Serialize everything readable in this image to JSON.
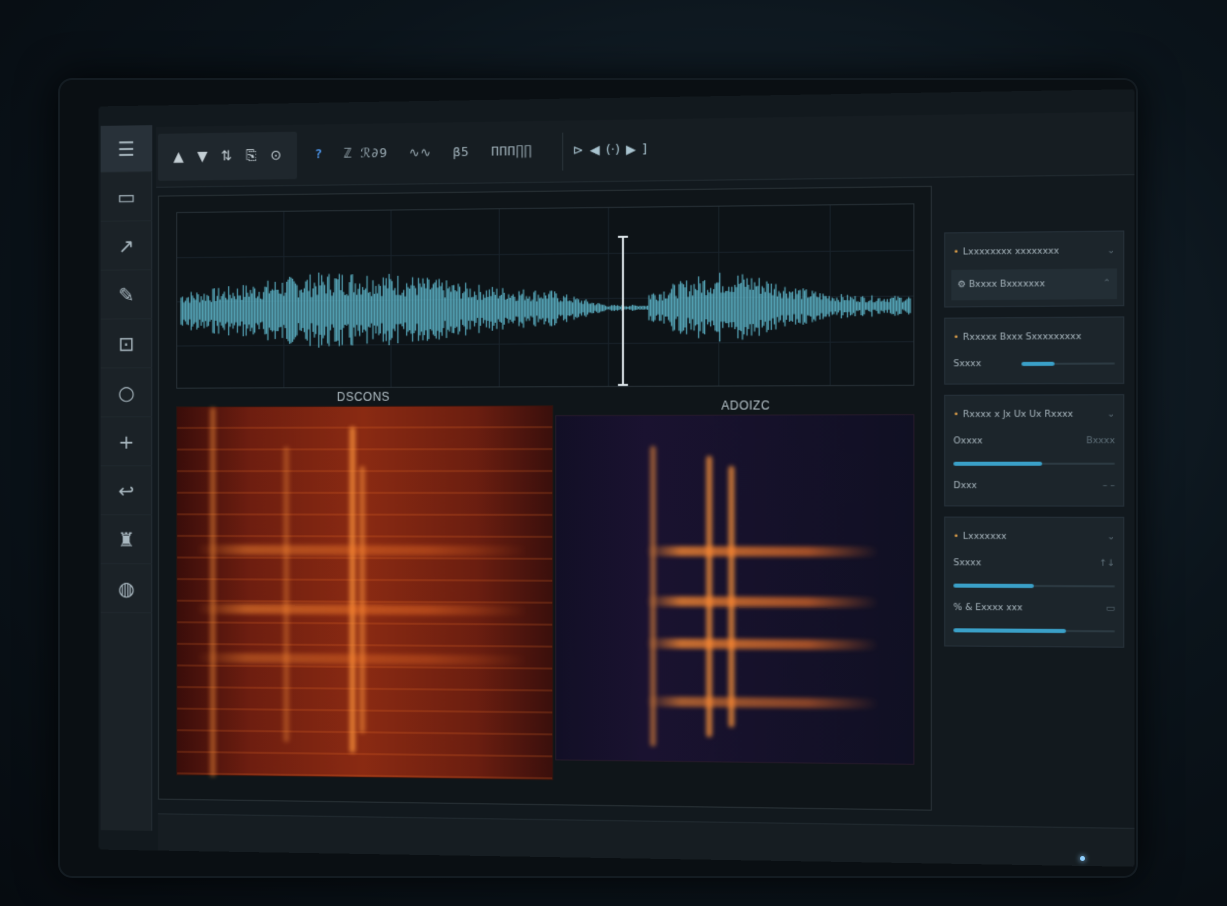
{
  "sidebar": {
    "items": [
      {
        "icon": "menu-icon",
        "glyph": "☰"
      },
      {
        "icon": "document-icon",
        "glyph": "▭"
      },
      {
        "icon": "hook-icon",
        "glyph": "↗"
      },
      {
        "icon": "pen-icon",
        "glyph": "✎"
      },
      {
        "icon": "clip-icon",
        "glyph": "⊡"
      },
      {
        "icon": "circle-icon",
        "glyph": "○"
      },
      {
        "icon": "plus-icon",
        "glyph": "+"
      },
      {
        "icon": "curve-icon",
        "glyph": "↩"
      },
      {
        "icon": "stamp-icon",
        "glyph": "♜"
      },
      {
        "icon": "globe-icon",
        "glyph": "◍"
      }
    ]
  },
  "toolbar": {
    "group_icons": [
      "▲",
      "▼",
      "⇅",
      "⎘",
      "⊙"
    ],
    "help": "?",
    "texts": [
      "ℤ ℛ∂9",
      "∿∿",
      "β5",
      "ΠΠΠ∏∏"
    ],
    "transport": {
      "left": "⊳",
      "prev": "◀",
      "play_pause": "(·)",
      "play": "▶",
      "end": "]"
    }
  },
  "main": {
    "wave_label": "DSCONS",
    "spec_label": "ADOIZC"
  },
  "right_panel": {
    "cards": [
      {
        "rows": [
          {
            "label": "Lxxxxxxxx xxxxxxxx",
            "tail": "⌄"
          },
          {
            "label": "⚙ Bxxxx Bxxxxxxx",
            "tail": "⌃",
            "sub": true
          }
        ]
      },
      {
        "rows": [
          {
            "label": "Rxxxxx Bxxx Sxxxxxxxxx",
            "tail": ""
          },
          {
            "label": "Sxxxx",
            "tail": "",
            "slider": 0.35
          }
        ]
      },
      {
        "rows": [
          {
            "label": "Rxxxx x Jx Ux Ux Rxxxx",
            "tail": "⌄"
          },
          {
            "label": "Oxxxx",
            "tail": "Bxxxx",
            "slider": 0.55
          },
          {
            "label": "Dxxx",
            "tail": "– –"
          }
        ]
      },
      {
        "rows": [
          {
            "label": "Lxxxxxxx",
            "tail": "⌄"
          },
          {
            "label": "Sxxxx",
            "tail": "↑↓",
            "slider": 0.5
          },
          {
            "label": "% & Exxxx xxx",
            "tail": "▭",
            "slider": 0.7
          }
        ]
      }
    ]
  },
  "colors": {
    "accent": "#3aa0c8",
    "waveform": "#5fb8cc",
    "spectrogram": "#ff7a2e"
  }
}
